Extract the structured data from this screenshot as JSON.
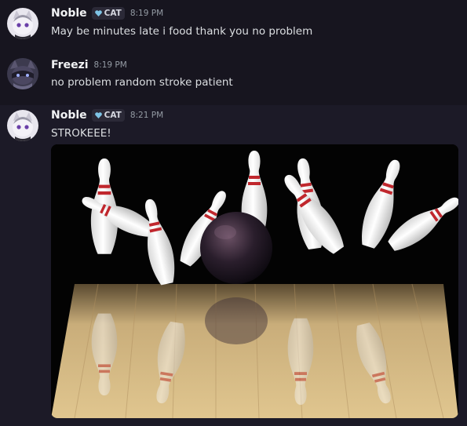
{
  "messages": [
    {
      "username": "Noble",
      "tag": "CAT",
      "time": "8:19 PM",
      "text": "May be minutes late i food thank you no problem"
    },
    {
      "username": "Freezi",
      "time": "8:19 PM",
      "text": "no problem random stroke patient"
    },
    {
      "username": "Noble",
      "tag": "CAT",
      "time": "8:21 PM",
      "text": "STROKEEE!",
      "attachment": "bowling-pins-strike-image"
    }
  ],
  "colors": {
    "background": "#17151f",
    "highlight_row": "#1c1a27",
    "username": "#f2f3f5",
    "timestamp": "#949ba4",
    "message_text": "#dbdee1",
    "tag_bg": "#2b2937",
    "tag_icon": "#7fc4e6"
  }
}
